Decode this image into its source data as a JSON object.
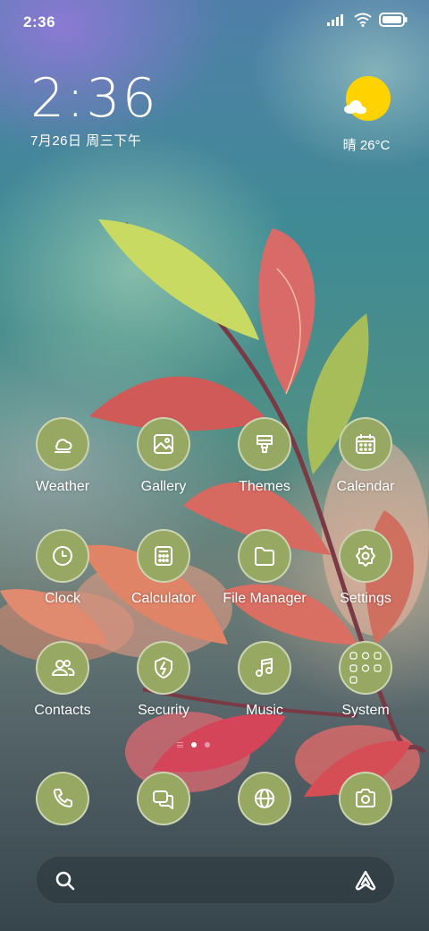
{
  "status_bar": {
    "time": "2:36",
    "icons": [
      "signal-icon",
      "wifi-icon",
      "battery-icon"
    ]
  },
  "clock_widget": {
    "time": "2:36",
    "date": "7月26日 周三下午"
  },
  "weather_widget": {
    "text": "晴 26°C",
    "icon": "sun-cloud-icon"
  },
  "apps": [
    {
      "label": "Weather",
      "icon": "weather-icon"
    },
    {
      "label": "Gallery",
      "icon": "gallery-icon"
    },
    {
      "label": "Themes",
      "icon": "themes-icon"
    },
    {
      "label": "Calendar",
      "icon": "calendar-icon"
    },
    {
      "label": "Clock",
      "icon": "clock-icon"
    },
    {
      "label": "Calculator",
      "icon": "calculator-icon"
    },
    {
      "label": "File Manager",
      "icon": "folder-icon"
    },
    {
      "label": "Settings",
      "icon": "gear-icon"
    },
    {
      "label": "Contacts",
      "icon": "contacts-icon"
    },
    {
      "label": "Security",
      "icon": "shield-icon"
    },
    {
      "label": "Music",
      "icon": "music-icon"
    },
    {
      "label": "System",
      "icon": "folder-grid-icon"
    }
  ],
  "page_indicator": {
    "pages": 2,
    "current": 1
  },
  "dock": [
    {
      "icon": "phone-icon"
    },
    {
      "icon": "messages-icon"
    },
    {
      "icon": "browser-icon"
    },
    {
      "icon": "camera-icon"
    }
  ],
  "search_bar": {
    "left_icon": "search-icon",
    "right_icon": "assistant-icon"
  },
  "colors": {
    "app_icon_bg": "#97a862",
    "icon_stroke": "#ffffff",
    "sun": "#ffd200"
  }
}
